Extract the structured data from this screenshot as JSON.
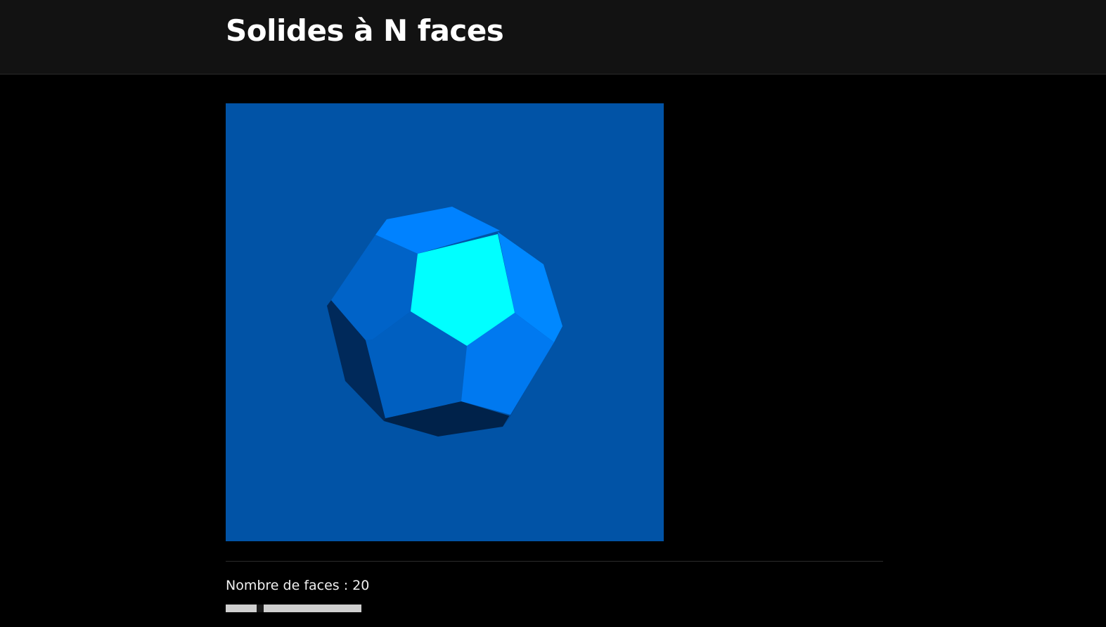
{
  "page": {
    "title": "Solides à N faces"
  },
  "viewer": {
    "background_color": "#0153a6",
    "solid": "dodecahedron"
  },
  "controls": {
    "faces_label": "Nombre de faces : 20",
    "faces_value": 20,
    "faces_slider_fraction": 0.24
  },
  "colors": {
    "header_bg": "#121212",
    "page_bg": "#000000",
    "face_highlight": "#00ffff",
    "face_light": "#0080ff",
    "face_mid": "#0060c4",
    "face_shadow": "#00224a"
  }
}
